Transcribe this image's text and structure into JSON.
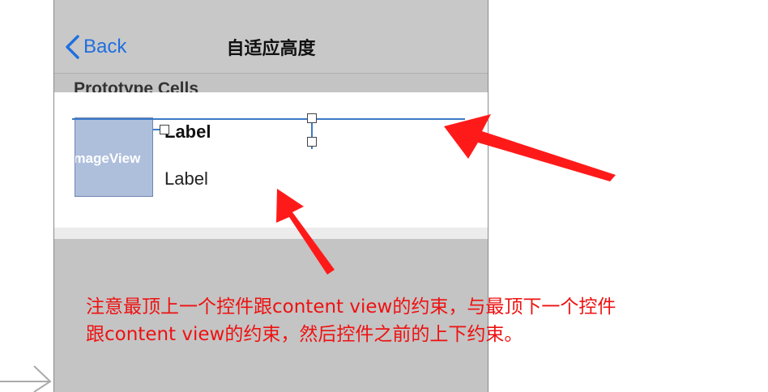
{
  "navbar": {
    "back_label": "Back",
    "title": "自适应高度"
  },
  "table": {
    "section_header": "Prototype Cells"
  },
  "cell": {
    "image_view_label": "IImageView",
    "title_label": "Label",
    "detail_label": "Label"
  },
  "annotation": {
    "line1": "注意最顶上一个控件跟content view的约束，与最顶下一个控件",
    "line2": "跟content view的约束，然后控件之前的上下约束。"
  },
  "colors": {
    "accent": "#1f6fe0",
    "constraint": "#3c7ac7",
    "arrow": "#ff1a1a",
    "image_view": "#aebfdc"
  },
  "icons": {
    "back": "chevron-left-icon",
    "arrow_right": "arrow-right-icon"
  }
}
